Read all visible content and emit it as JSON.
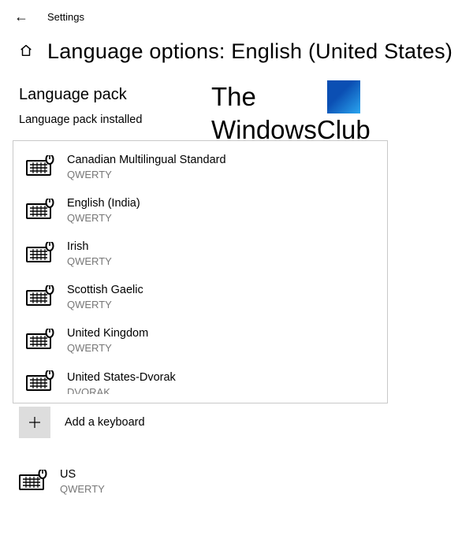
{
  "app_name": "Settings",
  "page_title": "Language options: English (United States)",
  "section": {
    "title": "Language pack",
    "status": "Language pack installed"
  },
  "watermark": {
    "line1": "The",
    "line2": "WindowsClub"
  },
  "keyboards": {
    "dropdown_items": [
      {
        "name": "Canadian Multilingual Standard",
        "layout": "QWERTY"
      },
      {
        "name": "English (India)",
        "layout": "QWERTY"
      },
      {
        "name": "Irish",
        "layout": "QWERTY"
      },
      {
        "name": "Scottish Gaelic",
        "layout": "QWERTY"
      },
      {
        "name": "United Kingdom",
        "layout": "QWERTY"
      },
      {
        "name": "United States-Dvorak",
        "layout": "DVORAK"
      }
    ],
    "add_label": "Add a keyboard",
    "installed": {
      "name": "US",
      "layout": "QWERTY"
    }
  }
}
